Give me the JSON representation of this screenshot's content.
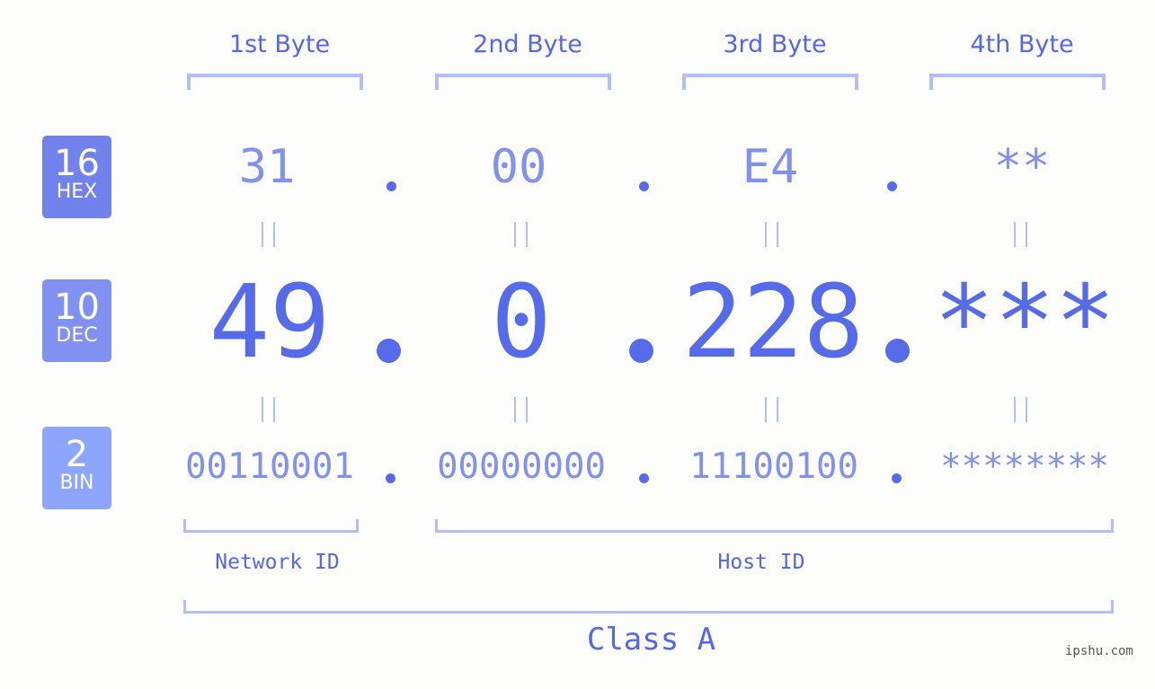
{
  "byte_headers": [
    "1st Byte",
    "2nd Byte",
    "3rd Byte",
    "4th Byte"
  ],
  "rows": {
    "hex": {
      "base": "16",
      "label": "HEX",
      "values": [
        "31",
        "00",
        "E4",
        "**"
      ]
    },
    "dec": {
      "base": "10",
      "label": "DEC",
      "values": [
        "49",
        "0",
        "228",
        "***"
      ]
    },
    "bin": {
      "base": "2",
      "label": "BIN",
      "values": [
        "00110001",
        "00000000",
        "11100100",
        "********"
      ]
    }
  },
  "segments": {
    "network": "Network ID",
    "host": "Host ID"
  },
  "ip_class": "Class A",
  "watermark": "ipshu.com",
  "colors": {
    "hex_badge": "#7282ec",
    "dec_badge": "#8191f2",
    "bin_badge": "#8da5fa",
    "primary_text": "#566be9",
    "secondary_text": "#8290ee",
    "bracket": "#b3bdf7"
  }
}
